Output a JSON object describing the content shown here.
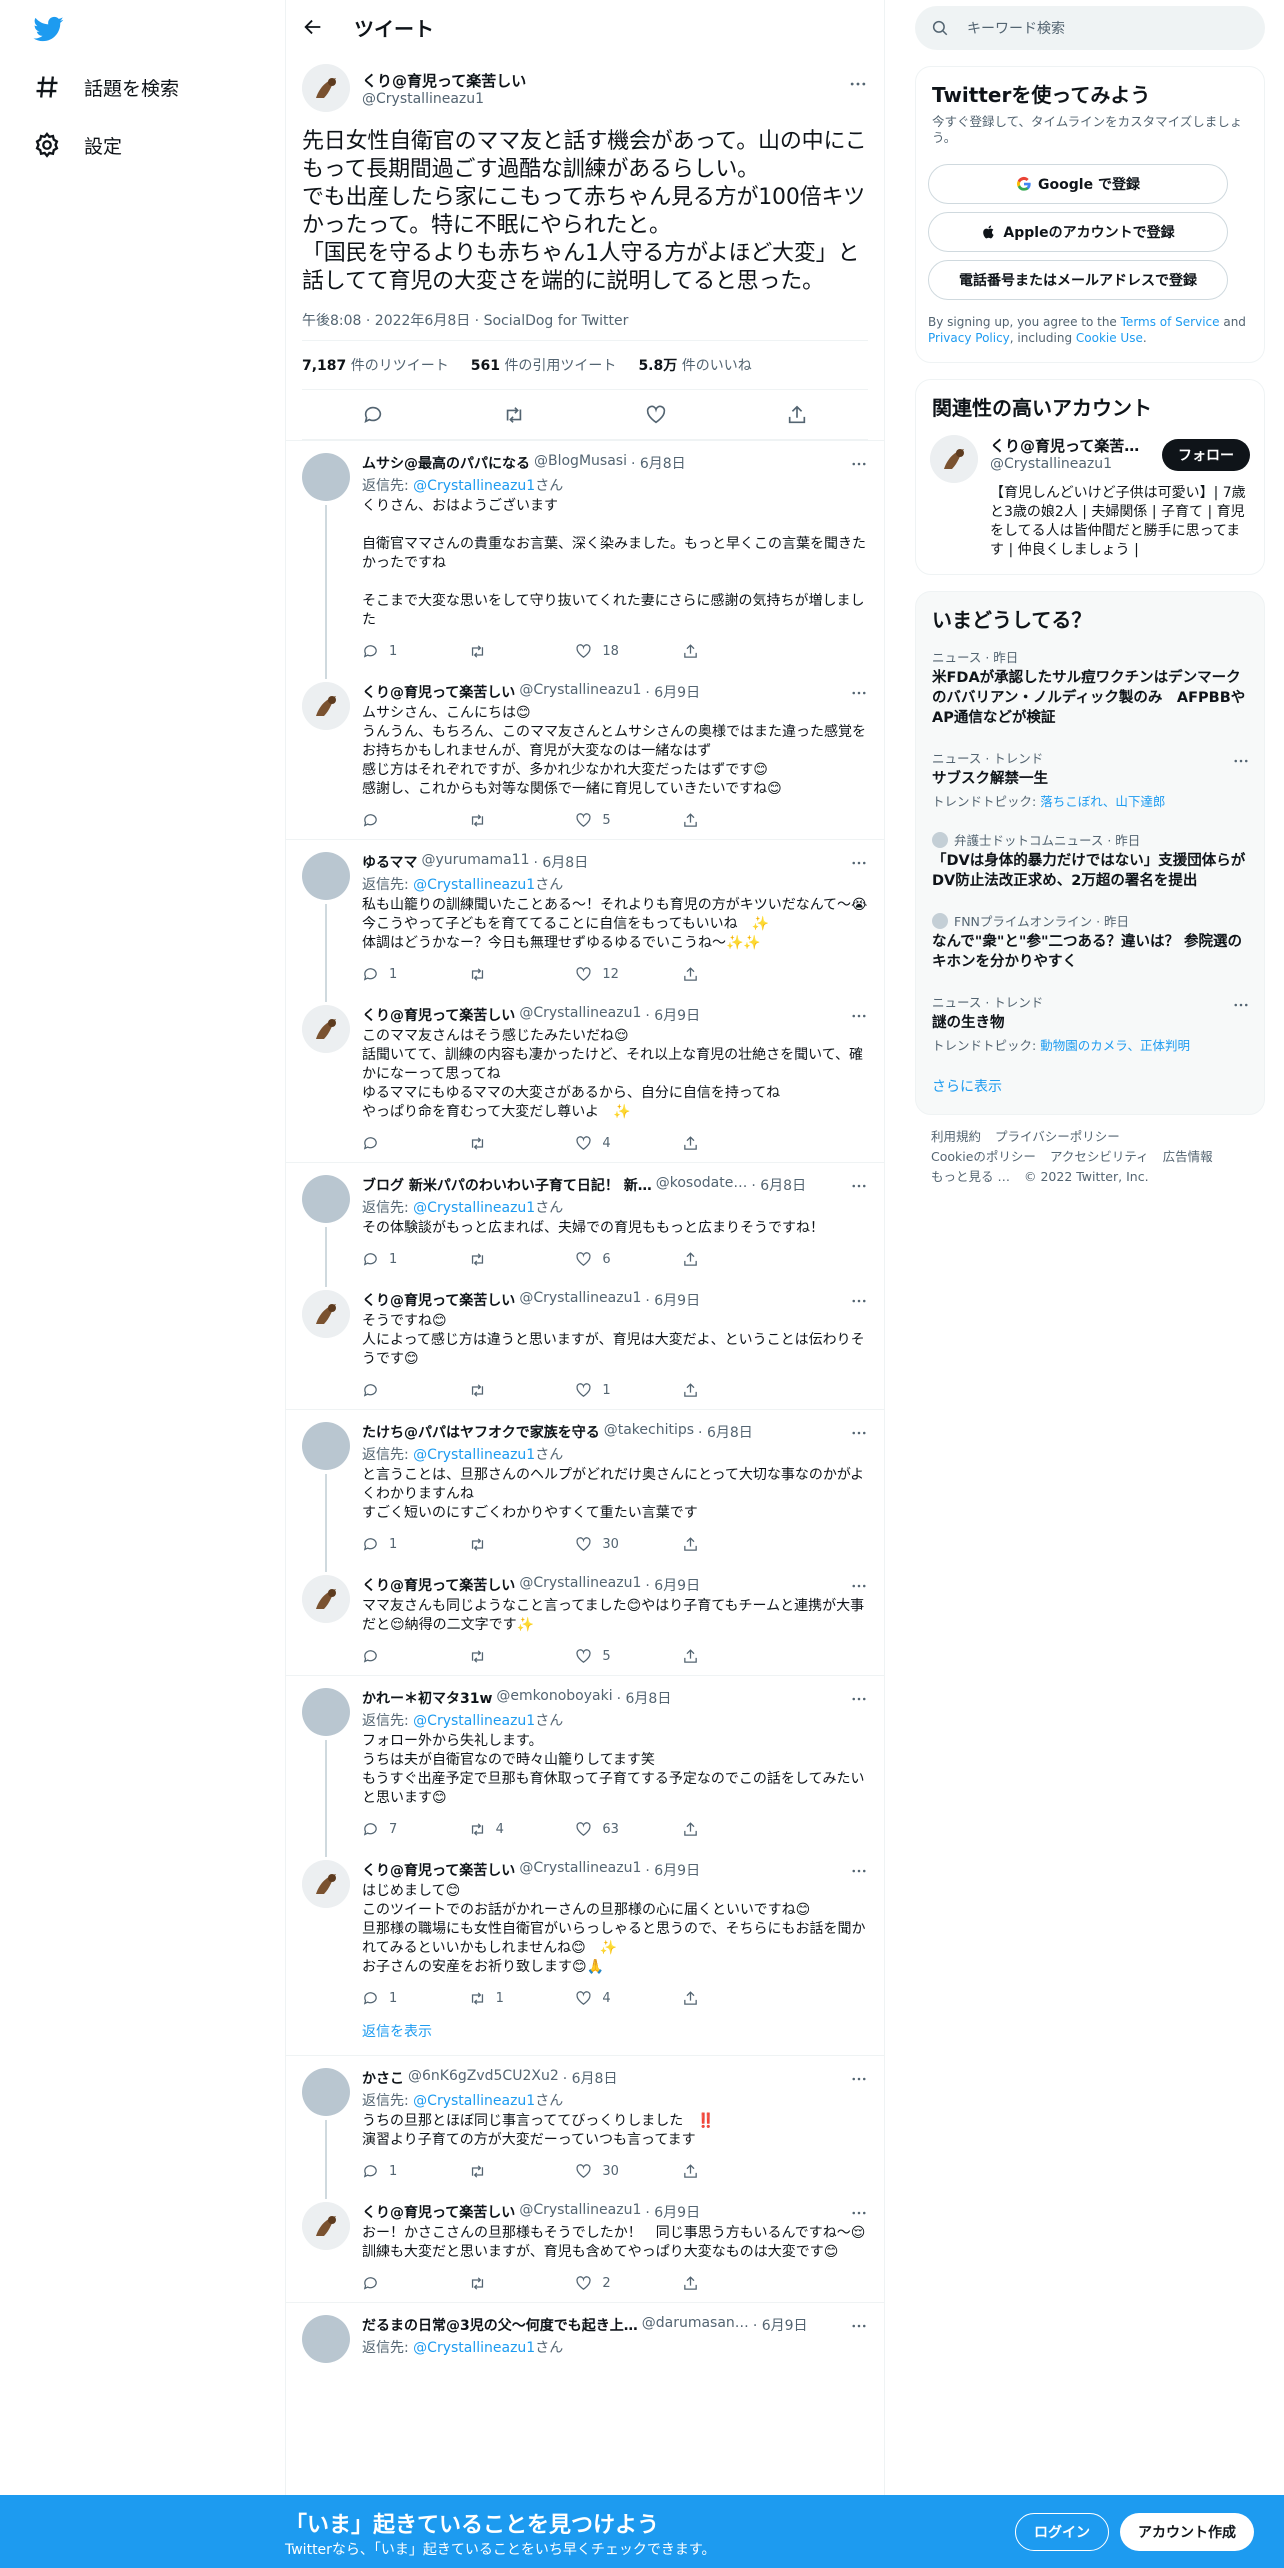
{
  "nav": {
    "items": [
      {
        "label": "話題を検索",
        "icon": "hash-icon"
      },
      {
        "label": "設定",
        "icon": "gear-icon"
      }
    ]
  },
  "header": {
    "title": "ツイート"
  },
  "main_tweet": {
    "display_name": "くり@育児って楽苦しい",
    "username": "@Crystallineazu1",
    "text": "先日女性自衛官のママ友と話す機会があって。山の中にこもって長期間過ごす過酷な訓練があるらしい。\nでも出産したら家にこもって赤ちゃん見る方が100倍キツかったって。特に不眠にやられたと。\n「国民を守るよりも赤ちゃん1人守る方がよほど大変」と話してて育児の大変さを端的に説明してると思った。",
    "meta": "午後8:08 · 2022年6月8日 · SocialDog for Twitter",
    "stats": [
      {
        "value": "7,187",
        "label": "件のリツイート"
      },
      {
        "value": "561",
        "label": "件の引用ツイート"
      },
      {
        "value": "5.8万",
        "label": "件のいいね"
      }
    ]
  },
  "replies": [
    {
      "name": "ムサシ@最高のパパになる",
      "user": "@BlogMusasi",
      "date": "· 6月8日",
      "reply_to_prefix": "返信先: ",
      "reply_to": "@Crystallineazu1",
      "reply_to_suffix": "さん",
      "text": "くりさん、おはようございます\n\n自衛官ママさんの貴重なお言葉、深く染みました。もっと早くこの言葉を聞きたかったですね\n\nそこまで大変な思いをして守り抜いてくれた妻にさらに感謝の気持ちが増しました",
      "counts": {
        "reply": "1",
        "retweet": "",
        "like": "18"
      }
    },
    {
      "name": "くり@育児って楽苦しい",
      "user": "@Crystallineazu1",
      "date": "· 6月9日",
      "text": "ムサシさん、こんにちは😊\nうんうん、もちろん、このママ友さんとムサシさんの奥様ではまた違った感覚をお持ちかもしれませんが、育児が大変なのは一緒なはず\n感じ方はそれぞれですが、多かれ少なかれ大変だったはずです😊\n感謝し、これからも対等な関係で一緒に育児していきたいですね😊",
      "counts": {
        "reply": "",
        "retweet": "",
        "like": "5"
      }
    },
    {
      "name": "ゆるママ",
      "user": "@yurumama11",
      "date": "· 6月8日",
      "reply_to_prefix": "返信先: ",
      "reply_to": "@Crystallineazu1",
      "reply_to_suffix": "さん",
      "text": "私も山籠りの訓練聞いたことある〜！それよりも育児の方がキツいだなんて〜😭今こうやって子どもを育ててることに自信をもってもいいね　✨\n体調はどうかなー？今日も無理せずゆるゆるでいこうね〜✨✨",
      "counts": {
        "reply": "1",
        "retweet": "",
        "like": "12"
      }
    },
    {
      "name": "くり@育児って楽苦しい",
      "user": "@Crystallineazu1",
      "date": "· 6月9日",
      "text": "このママ友さんはそう感じたみたいだね😌\n話聞いてて、訓練の内容も凄かったけど、それ以上な育児の壮絶さを聞いて、確かになーって思ってね\nゆるママにもゆるママの大変さがあるから、自分に自信を持ってね\nやっぱり命を育むって大変だし尊いよ　✨",
      "counts": {
        "reply": "",
        "retweet": "",
        "like": "4"
      }
    },
    {
      "name": "ブログ 新米パパのわいわい子育て日記！ 新…",
      "user": "@kosodate…",
      "date": "· 6月8日",
      "reply_to_prefix": "返信先: ",
      "reply_to": "@Crystallineazu1",
      "reply_to_suffix": "さん",
      "text": "その体験談がもっと広まれば、夫婦での育児ももっと広まりそうですね！",
      "counts": {
        "reply": "1",
        "retweet": "",
        "like": "6"
      }
    },
    {
      "name": "くり@育児って楽苦しい",
      "user": "@Crystallineazu1",
      "date": "· 6月9日",
      "text": "そうですね😊\n人によって感じ方は違うと思いますが、育児は大変だよ、ということは伝わりそうです😊",
      "counts": {
        "reply": "",
        "retweet": "",
        "like": "1"
      }
    },
    {
      "name": "たけち@パパはヤフオクで家族を守る",
      "user": "@takechitips",
      "date": "· 6月8日",
      "reply_to_prefix": "返信先: ",
      "reply_to": "@Crystallineazu1",
      "reply_to_suffix": "さん",
      "text": "と言うことは、旦那さんのヘルプがどれだけ奥さんにとって大切な事なのかがよくわかりますんね\nすごく短いのにすごくわかりやすくて重たい言葉です",
      "counts": {
        "reply": "1",
        "retweet": "",
        "like": "30"
      }
    },
    {
      "name": "くり@育児って楽苦しい",
      "user": "@Crystallineazu1",
      "date": "· 6月9日",
      "text": "ママ友さんも同じようなこと言ってました😊やはり子育てもチームと連携が大事だと😌納得の二文字です✨",
      "counts": {
        "reply": "",
        "retweet": "",
        "like": "5"
      }
    },
    {
      "name": "かれー＊初マタ31w",
      "user": "@emkonoboyaki",
      "date": "· 6月8日",
      "reply_to_prefix": "返信先: ",
      "reply_to": "@Crystallineazu1",
      "reply_to_suffix": "さん",
      "text": "フォロー外から失礼します。\nうちは夫が自衛官なので時々山籠りしてます笑\nもうすぐ出産予定で旦那も育休取って子育てする予定なのでこの話をしてみたいと思います😊",
      "counts": {
        "reply": "7",
        "retweet": "4",
        "like": "63"
      }
    },
    {
      "name": "くり@育児って楽苦しい",
      "user": "@Crystallineazu1",
      "date": "· 6月9日",
      "text": "はじめまして😊\nこのツイートでのお話がかれーさんの旦那様の心に届くといいですね😊\n旦那様の職場にも女性自衛官がいらっしゃると思うので、そちらにもお話を聞かれてみるといいかもしれませんね😊　✨\nお子さんの安産をお祈り致します😊🙏",
      "counts": {
        "reply": "1",
        "retweet": "1",
        "like": "4"
      }
    },
    {
      "name": "かさこ",
      "user": "@6nK6gZvd5CU2Xu2",
      "date": "· 6月8日",
      "reply_to_prefix": "返信先: ",
      "reply_to": "@Crystallineazu1",
      "reply_to_suffix": "さん",
      "text": "うちの旦那とほぼ同じ事言っててびっくりしました　‼️\n演習より子育ての方が大変だーっていつも言ってます",
      "counts": {
        "reply": "1",
        "retweet": "",
        "like": "30"
      }
    },
    {
      "name": "くり@育児って楽苦しい",
      "user": "@Crystallineazu1",
      "date": "· 6月9日",
      "text": "おー！かさこさんの旦那様もそうでしたか！　同じ事思う方もいるんですね〜😌訓練も大変だと思いますが、育児も含めてやっぱり大変なものは大変です😊",
      "counts": {
        "reply": "",
        "retweet": "",
        "like": "2"
      }
    },
    {
      "name": "だるまの日常@3児の父～何度でも起き上…",
      "user": "@darumasan…",
      "date": "· 6月9日",
      "reply_to_prefix": "返信先: ",
      "reply_to": "@Crystallineazu1",
      "reply_to_suffix": "さん",
      "text": "",
      "counts": {
        "reply": "",
        "retweet": "",
        "like": ""
      }
    }
  ],
  "show_replies_label": "返信を表示",
  "right": {
    "search_placeholder": "キーワード検索",
    "signup": {
      "title": "Twitterを使ってみよう",
      "subtitle": "今すぐ登録して、タイムラインをカスタマイズしましょう。",
      "google": "Google で登録",
      "apple": "Appleのアカウントで登録",
      "phone": "電話番号またはメールアドレスで登録",
      "legal_1": "By signing up, you agree to the ",
      "terms": "Terms of Service",
      "legal_2": " and ",
      "privacy": "Privacy Policy",
      "legal_3": ", including ",
      "cookie": "Cookie Use",
      "legal_4": "."
    },
    "related": {
      "title": "関連性の高いアカウント",
      "name": "くり@育児って楽苦…",
      "user": "@Crystallineazu1",
      "follow": "フォロー",
      "bio": "【育児しんどいけど子供は可愛い】| 7歳と3歳の娘2人 | 夫婦関係 | 子育て | 育児をしてる人は皆仲間だと勝手に思ってます | 仲良くしましょう |"
    },
    "trends": {
      "title": "いまどうしてる？",
      "items": [
        {
          "category": "ニュース · 昨日",
          "title": "米FDAが承認したサル痘ワクチンはデンマークのババリアン・ノルディック製のみ　AFPBBやAP通信などが検証",
          "sub": ""
        },
        {
          "category": "ニュース · トレンド",
          "title": "サブスク解禁一生",
          "sub_prefix": "トレンドトピック: ",
          "sub_link": "落ちこぼれ、山下達郎"
        },
        {
          "category": "弁護士ドットコムニュース · 昨日",
          "title": "「DVは身体的暴力だけではない」支援団体らがDV防止法改正求め、2万超の署名を提出",
          "sub": ""
        },
        {
          "category": "FNNプライムオンライン · 昨日",
          "title": "なんで\"衆\"と\"参\"二つある？違いは？ 参院選のキホンを分かりやすく",
          "sub": ""
        },
        {
          "category": "ニュース · トレンド",
          "title": "謎の生き物",
          "sub_prefix": "トレンドトピック: ",
          "sub_link": "動物園のカメラ、正体判明"
        }
      ],
      "show_more": "さらに表示"
    },
    "footer": {
      "links": [
        "利用規約",
        "プライバシーポリシー",
        "Cookieのポリシー",
        "アクセシビリティ",
        "広告情報",
        "もっと見る …",
        "© 2022 Twitter, Inc."
      ]
    }
  },
  "bottom_bar": {
    "title": "「いま」起きていることを見つけよう",
    "subtitle": "Twitterなら、「いま」起きていることをいち早くチェックできます。",
    "login": "ログイン",
    "signup": "アカウント作成"
  },
  "colors": {
    "accent": "#1d9bf0",
    "text": "#0f1419",
    "muted": "#536471",
    "border": "#eff3f4"
  }
}
